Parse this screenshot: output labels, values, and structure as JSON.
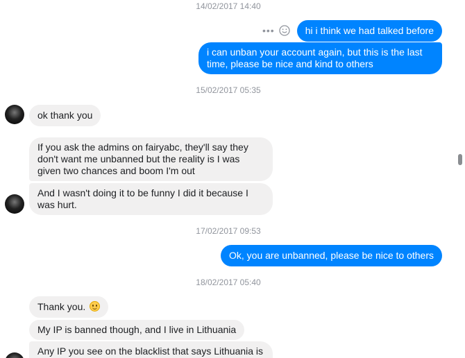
{
  "thread": {
    "timestamps": [
      "14/02/2017 14:40",
      "15/02/2017 05:35",
      "17/02/2017 09:53",
      "18/02/2017 05:40"
    ],
    "messages": [
      {
        "from": "me",
        "text": "hi i think we had talked before"
      },
      {
        "from": "me",
        "text": "i can unban your account again, but this is the last time, please be nice and kind to others"
      },
      {
        "from": "them",
        "text": "ok thank you"
      },
      {
        "from": "them",
        "text": "If you ask the admins on fairyabc, they'll say they don't want me unbanned but the reality is I was given two chances and boom I'm out"
      },
      {
        "from": "them",
        "text": "And I wasn't doing it to be funny I did it because I was hurt."
      },
      {
        "from": "me",
        "text": "Ok, you are unbanned, please be nice  to others"
      },
      {
        "from": "them",
        "text": "Thank you."
      },
      {
        "from": "them",
        "text": "My IP is banned though, and I live in Lithuania"
      },
      {
        "from": "them",
        "text": "Any IP you see on the blacklist that says Lithuania is"
      }
    ]
  },
  "icons": {
    "more": "more-options-icon",
    "reaction": "emoji-reaction-icon",
    "smile": "smiling-face-emoji-icon",
    "avatar": "user-avatar"
  },
  "colors": {
    "outgoing": "#0084ff",
    "incoming": "#f1f0f0",
    "timestamp": "#90949c"
  }
}
